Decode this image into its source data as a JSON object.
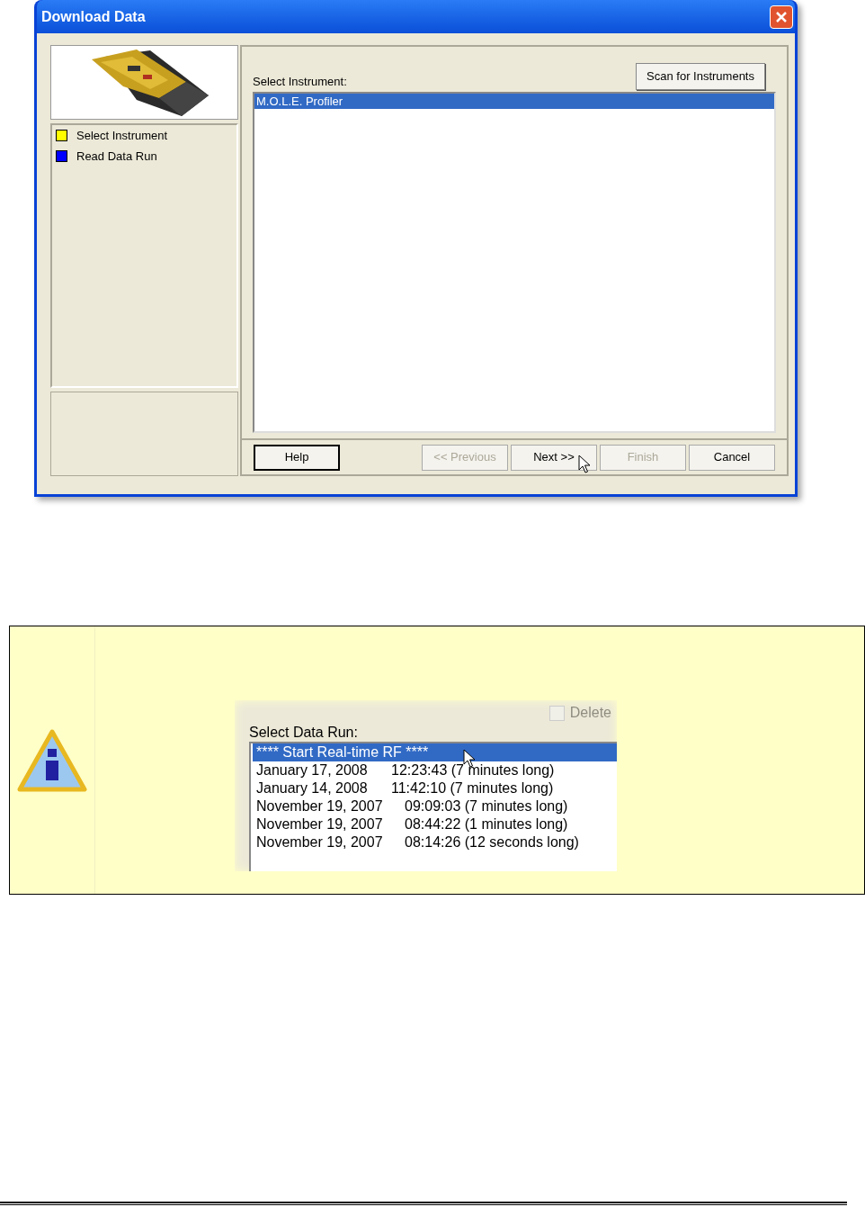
{
  "dialog": {
    "title": "Download Data",
    "steps": [
      {
        "label": "Select Instrument",
        "color": "#ffff00"
      },
      {
        "label": "Read Data Run",
        "color": "#0000ff"
      }
    ],
    "instrument_label": "Select Instrument:",
    "scan_button": "Scan for Instruments",
    "instruments": [
      {
        "label": "M.O.L.E. Profiler",
        "selected": true
      }
    ],
    "buttons": [
      {
        "label": "Help",
        "disabled": false,
        "default": true
      },
      {
        "label": "<< Previous",
        "disabled": true,
        "default": false
      },
      {
        "label": "Next >>",
        "disabled": false,
        "default": false
      },
      {
        "label": "Finish",
        "disabled": true,
        "default": false
      },
      {
        "label": "Cancel",
        "disabled": false,
        "default": false
      }
    ]
  },
  "note": {
    "delete_checkbox": {
      "label": "Delete",
      "checked": false,
      "disabled": true
    },
    "runs_label": "Select Data Run:",
    "runs": [
      {
        "date": "**** Start Real-time RF ****",
        "selected": true
      },
      {
        "date": "January 17, 2008",
        "time": "12:23:43 (7 minutes long)",
        "selected": false
      },
      {
        "date": "January 14, 2008",
        "time": "11:42:10 (7 minutes long)",
        "selected": false
      },
      {
        "date": "November 19, 2007",
        "time": "09:09:03 (7 minutes long)",
        "selected": false
      },
      {
        "date": "November 19, 2007",
        "time": "08:44:22 (1 minutes long)",
        "selected": false
      },
      {
        "date": "November 19, 2007",
        "time": "08:14:26 (12 seconds long)",
        "selected": false
      }
    ]
  }
}
